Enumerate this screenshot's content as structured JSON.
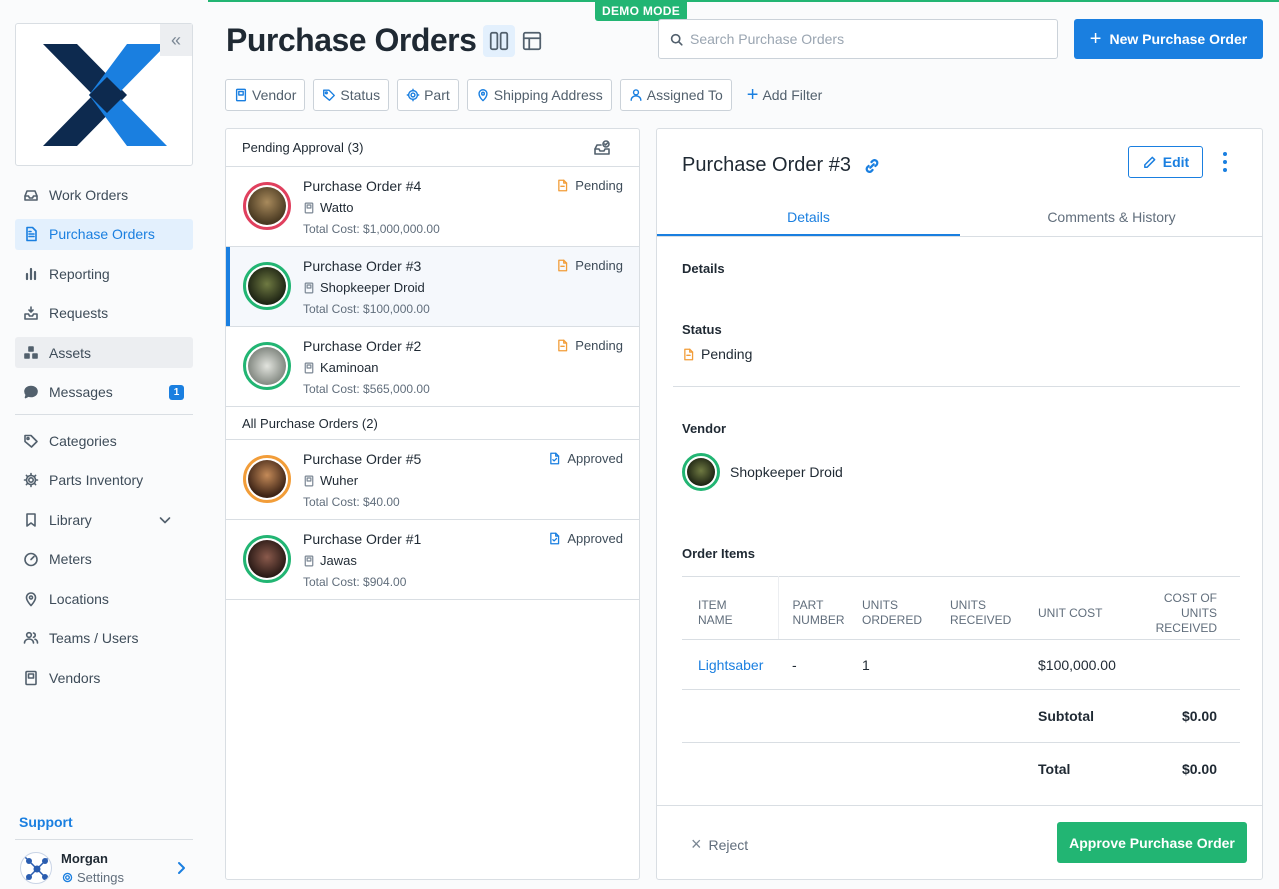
{
  "demo_badge": "DEMO MODE",
  "sidebar": {
    "collapse_glyph": "«",
    "items": [
      {
        "label": "Work Orders",
        "icon": "inbox-icon"
      },
      {
        "label": "Purchase Orders",
        "icon": "document-icon",
        "active": true
      },
      {
        "label": "Reporting",
        "icon": "bar-chart-icon"
      },
      {
        "label": "Requests",
        "icon": "tray-icon"
      },
      {
        "label": "Assets",
        "icon": "cubes-icon"
      },
      {
        "label": "Messages",
        "icon": "chat-icon",
        "badge": "1"
      },
      {
        "label": "Categories",
        "icon": "tag-icon"
      },
      {
        "label": "Parts Inventory",
        "icon": "gear-icon"
      },
      {
        "label": "Library",
        "icon": "bookmark-icon"
      },
      {
        "label": "Meters",
        "icon": "gauge-icon"
      },
      {
        "label": "Locations",
        "icon": "map-pin-icon"
      },
      {
        "label": "Teams / Users",
        "icon": "users-icon"
      },
      {
        "label": "Vendors",
        "icon": "vendor-icon"
      }
    ],
    "support_label": "Support",
    "user": {
      "name": "Morgan",
      "settings_label": "Settings"
    }
  },
  "header": {
    "title": "Purchase Orders",
    "search_placeholder": "Search Purchase Orders",
    "new_button_label": "New Purchase Order",
    "filters": [
      "Vendor",
      "Status",
      "Part",
      "Shipping Address",
      "Assigned To"
    ],
    "add_filter_label": "Add Filter"
  },
  "list": {
    "groups": [
      {
        "title": "Pending Approval (3)",
        "rows": [
          {
            "title": "Purchase Order #4",
            "vendor": "Watto",
            "cost": "Total Cost: $1,000,000.00",
            "status": "Pending",
            "status_color": "#f29d39",
            "ring_color": "#e0405e",
            "avatar_color": "#8a6a3e"
          },
          {
            "title": "Purchase Order #3",
            "vendor": "Shopkeeper Droid",
            "cost": "Total Cost: $100,000.00",
            "status": "Pending",
            "status_color": "#f29d39",
            "ring_color": "#22b573",
            "avatar_color": "#2f3a24",
            "selected": true
          },
          {
            "title": "Purchase Order #2",
            "vendor": "Kaminoan",
            "cost": "Total Cost: $565,000.00",
            "status": "Pending",
            "status_color": "#f29d39",
            "ring_color": "#22b573",
            "avatar_color": "#b9bcb8"
          }
        ]
      },
      {
        "title": "All Purchase Orders (2)",
        "rows": [
          {
            "title": "Purchase Order #5",
            "vendor": "Wuher",
            "cost": "Total Cost: $40.00",
            "status": "Approved",
            "status_color": "#1a7fe0",
            "ring_color": "#f29d39",
            "avatar_color": "#7a4c2e"
          },
          {
            "title": "Purchase Order #1",
            "vendor": "Jawas",
            "cost": "Total Cost: $904.00",
            "status": "Approved",
            "status_color": "#1a7fe0",
            "ring_color": "#22b573",
            "avatar_color": "#5a3d35"
          }
        ]
      }
    ]
  },
  "detail": {
    "title": "Purchase Order #3",
    "edit_label": "Edit",
    "tabs": [
      "Details",
      "Comments & History"
    ],
    "details_label": "Details",
    "status_label": "Status",
    "status_value": "Pending",
    "vendor_label": "Vendor",
    "vendor_name": "Shopkeeper Droid",
    "order_items_label": "Order Items",
    "table": {
      "headers": [
        [
          "ITEM",
          "NAME"
        ],
        [
          "PART",
          "NUMBER"
        ],
        [
          "UNITS",
          "ORDERED"
        ],
        [
          "UNITS",
          "RECEIVED"
        ],
        [
          "UNIT COST"
        ],
        [
          "COST OF",
          "UNITS",
          "RECEIVED"
        ]
      ],
      "rows": [
        {
          "item": "Lightsaber",
          "part": "-",
          "ordered": "1",
          "received": "",
          "unit_cost": "$100,000.00",
          "cost_received": ""
        }
      ],
      "subtotal_label": "Subtotal",
      "subtotal_value": "$0.00",
      "total_label": "Total",
      "total_value": "$0.00"
    },
    "reject_label": "Reject",
    "approve_label": "Approve Purchase Order"
  }
}
